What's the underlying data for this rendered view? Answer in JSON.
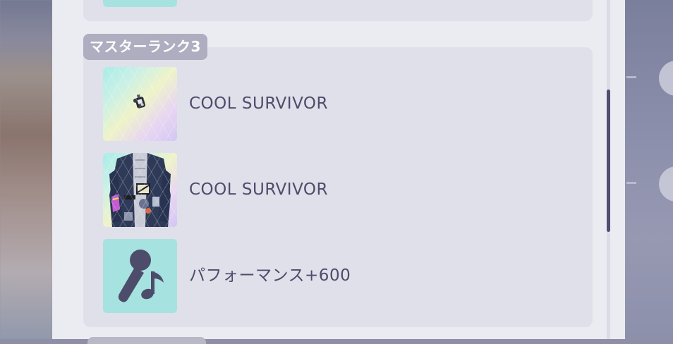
{
  "section": {
    "rank_label": "マスターランク3"
  },
  "rewards": [
    {
      "label": "COOL SURVIVOR",
      "icon": "accessory-badge-icon"
    },
    {
      "label": "COOL SURVIVOR",
      "icon": "jacket-costume-icon"
    },
    {
      "label": "パフォーマンス+600",
      "icon": "microphone-note-icon"
    }
  ],
  "colors": {
    "panel_bg": "#ebebf2",
    "section_bg": "#e0e0ea",
    "label_bg": "#aeaec0",
    "text": "#4d4c6b",
    "icon_bg": "#a6e3e0",
    "scroll_thumb": "#4f4e73"
  }
}
